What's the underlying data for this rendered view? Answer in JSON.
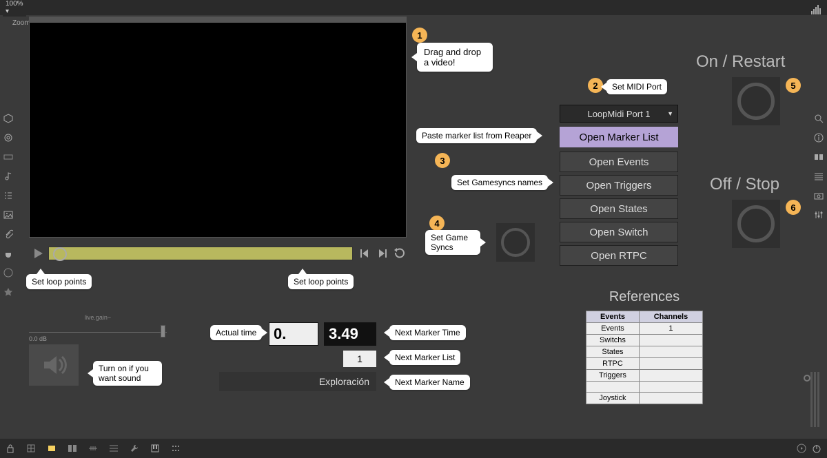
{
  "topbar": {
    "zoom": "100% ▾",
    "zoom_label": "Zoom"
  },
  "callouts": {
    "drag_video": "Drag and drop a video!",
    "set_midi": "Set MIDI Port",
    "paste_marker": "Paste marker list from Reaper",
    "set_gamesync_names": "Set Gamesyncs names",
    "set_game_syncs": "Set Game\nSyncs",
    "loop_left": "Set loop points",
    "loop_right": "Set loop points",
    "actual_time": "Actual time",
    "next_marker_time": "Next Marker Time",
    "next_marker_list": "Next Marker List",
    "next_marker_name": "Next Marker Name",
    "turn_on_sound": "Turn on if you want sound"
  },
  "badges": {
    "b1": "1",
    "b2": "2",
    "b3": "3",
    "b4": "4",
    "b5": "5",
    "b6": "6"
  },
  "midi": {
    "selected": "LoopMidi Port 1"
  },
  "buttons": {
    "marker_list": "Open Marker List",
    "events": "Open Events",
    "triggers": "Open Triggers",
    "states": "Open States",
    "switch": "Open Switch",
    "rtpc": "Open RTPC"
  },
  "headings": {
    "on_restart": "On / Restart",
    "off_stop": "Off / Stop"
  },
  "gain": {
    "label": "live.gain~",
    "db": "0.0 dB"
  },
  "times": {
    "actual": "0.",
    "next": "3.49",
    "list_num": "1",
    "name": "Exploración"
  },
  "refs": {
    "title": "References",
    "headers": {
      "events": "Events",
      "channels": "Channels"
    },
    "rows": [
      {
        "name": "Events",
        "ch": "1"
      },
      {
        "name": "Switchs",
        "ch": ""
      },
      {
        "name": "States",
        "ch": ""
      },
      {
        "name": "RTPC",
        "ch": ""
      },
      {
        "name": "Triggers",
        "ch": ""
      },
      {
        "name": "",
        "ch": ""
      },
      {
        "name": "Joystick",
        "ch": ""
      }
    ]
  }
}
